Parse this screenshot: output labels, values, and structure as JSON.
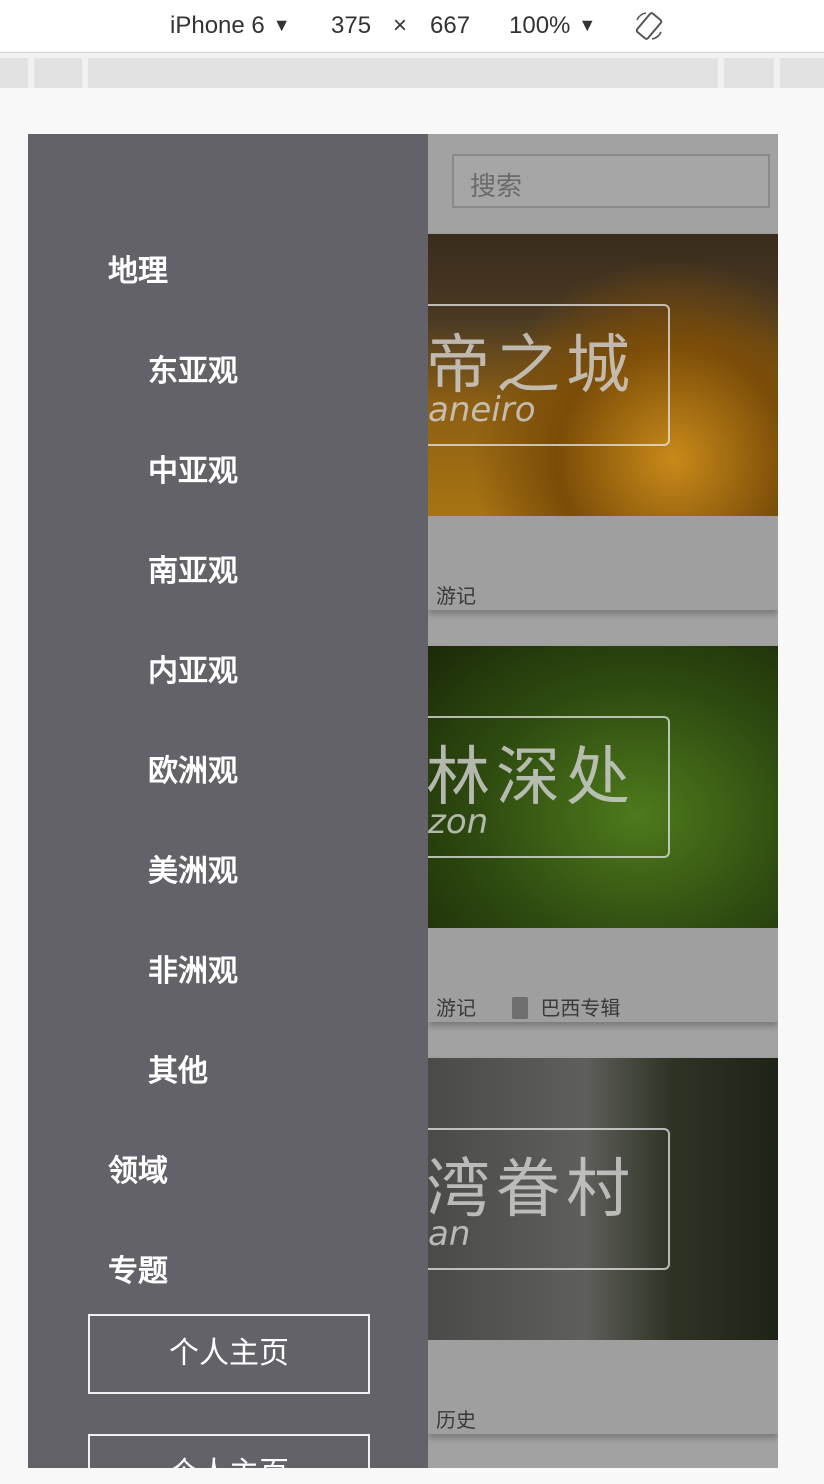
{
  "devtools": {
    "device": "iPhone 6",
    "width": "375",
    "times": "×",
    "height": "667",
    "zoom": "100%"
  },
  "search": {
    "placeholder": "搜索"
  },
  "sidebar": {
    "geography": "地理",
    "geo_items": [
      "东亚观",
      "中亚观",
      "南亚观",
      "内亚观",
      "欧洲观",
      "美洲观",
      "非洲观",
      "其他"
    ],
    "fields": "领域",
    "topics": "专题",
    "buttons": [
      "个人主页",
      "个人主页"
    ]
  },
  "cards": [
    {
      "image_title": "帝之城",
      "image_subtitle": "aneiro",
      "category": "游记",
      "album": ""
    },
    {
      "image_title": "林深处",
      "image_subtitle": "zon",
      "category": "游记",
      "album": "巴西专辑"
    },
    {
      "image_title": "湾眷村",
      "image_subtitle": "an",
      "category": "历史",
      "album": ""
    }
  ]
}
